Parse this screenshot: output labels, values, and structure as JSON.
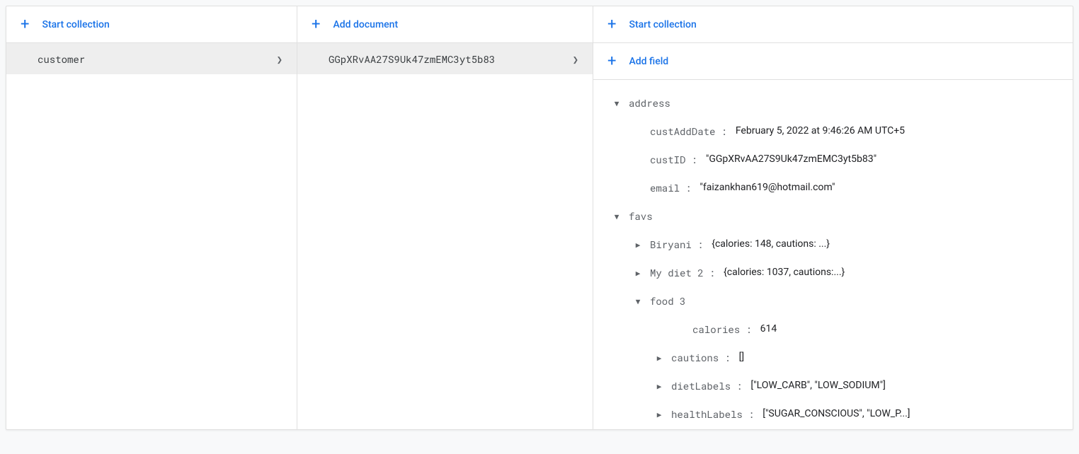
{
  "collectionsPanel": {
    "startCollection": "Start collection",
    "items": [
      {
        "name": "customer",
        "selected": true
      }
    ]
  },
  "documentsPanel": {
    "addDocument": "Add document",
    "items": [
      {
        "id": "GGpXRvAA27S9Uk47zmEMC3yt5b83",
        "selected": true
      }
    ]
  },
  "fieldsPanel": {
    "startCollection": "Start collection",
    "addField": "Add field",
    "fields": {
      "address": {
        "label": "address"
      },
      "custAddDate": {
        "key": "custAddDate",
        "value": "February 5, 2022 at 9:46:26 AM UTC+5"
      },
      "custID": {
        "key": "custID",
        "value": "\"GGpXRvAA27S9Uk47zmEMC3yt5b83\""
      },
      "email": {
        "key": "email",
        "value": "\"faizankhan619@hotmail.com\""
      },
      "favs": {
        "label": "favs",
        "children": {
          "biryani": {
            "key": "Biryani ",
            "preview": "{calories: 148, cautions: ...}"
          },
          "mydiet2": {
            "key": "My diet 2",
            "preview": "{calories: 1037, cautions:...}"
          },
          "food3": {
            "key": "food 3",
            "children": {
              "calories": {
                "key": "calories",
                "value": "614"
              },
              "cautions": {
                "key": "cautions",
                "value": "[]"
              },
              "dietLabels": {
                "key": "dietLabels",
                "value": "[\"LOW_CARB\", \"LOW_SODIUM\"]"
              },
              "healthLabels": {
                "key": "healthLabels",
                "value": "[\"SUGAR_CONSCIOUS\", \"LOW_P...]"
              }
            }
          }
        }
      }
    }
  }
}
